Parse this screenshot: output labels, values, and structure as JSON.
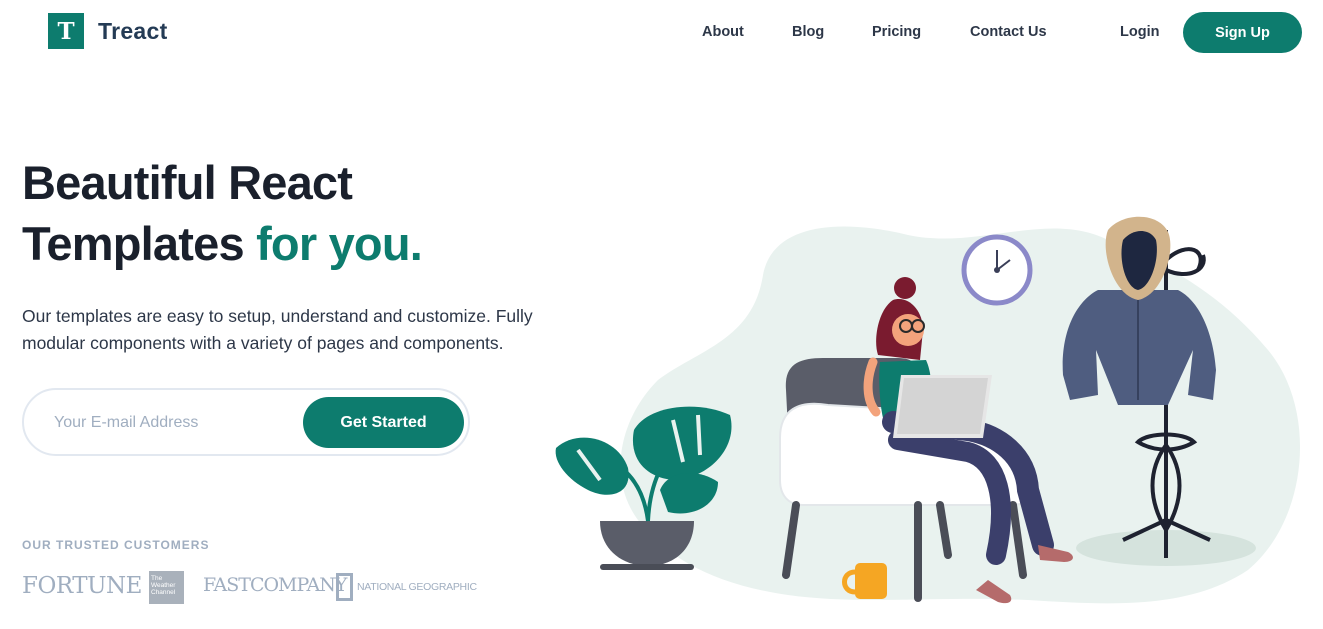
{
  "brand": {
    "mark": "T",
    "name": "Treact"
  },
  "nav": {
    "about": "About",
    "blog": "Blog",
    "pricing": "Pricing",
    "contact": "Contact Us",
    "login": "Login",
    "signup": "Sign Up"
  },
  "hero": {
    "title_line1": "Beautiful React",
    "title_line2": "Templates",
    "title_accent": "for you.",
    "description": "Our templates are easy to setup, understand and customize. Fully modular components with a variety of pages and components."
  },
  "signup_form": {
    "email_placeholder": "Your E-mail Address",
    "email_value": "",
    "button": "Get Started"
  },
  "customers": {
    "label": "OUR TRUSTED CUSTOMERS",
    "logos": [
      "FORTUNE",
      "The Weather Channel",
      "FASTCOMPANY",
      "NATIONAL GEOGRAPHIC"
    ]
  },
  "colors": {
    "primary": "#0d7c6e",
    "heading": "#1a202c",
    "muted": "#a0aec0",
    "blob": "#e9f2ef"
  }
}
